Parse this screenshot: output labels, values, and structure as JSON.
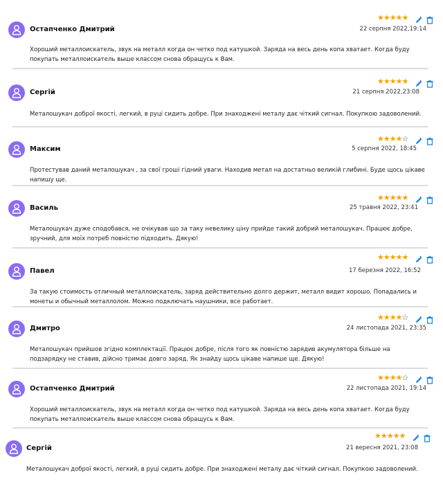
{
  "icons": {
    "avatar": "user-avatar-icon",
    "edit": "pencil-icon",
    "delete": "trash-icon",
    "star": "star-icon"
  },
  "colors": {
    "avatar": "#8a6cf2",
    "star": "#f5a300",
    "action": "#1e88e5",
    "divider": "#dcdcdc"
  },
  "reviews": [
    {
      "name": "Остапченко Дмитрий",
      "date": "22 серпня 2022,19:14",
      "rating": 5,
      "text": "Хороший металлоискатель, звук на металл когда он четко под катушкой. Заряда на весь день копа хватает. Когда буду покупать металлоискатель выше классом снова обращусь к Вам."
    },
    {
      "name": "Сергій",
      "date": "21 серпня 2022,23:08",
      "rating": 5,
      "text": "Металошукач доброї якості, легкий, в руці сидить добре. При знаходжені металу дає чіткий сигнал. Покупкою задоволений."
    },
    {
      "name": "Максим",
      "date": "5 серпня 2022, 18:45",
      "rating": 4,
      "text": "Протестував даний металошукач , за свої гроші гідний уваги. Находив метал на достатньо великій глибині. Буде щось цікаве напишу ще."
    },
    {
      "name": "Василь",
      "date": "25 травня 2022, 23:41",
      "rating": 5,
      "text": "Металошукач дуже сподобався, не очікував що за таку невелику ціну прийде такий добрий металошукач. Працює добре, зручний, для моїх потреб повністю підходить. Дякую!"
    },
    {
      "name": "Павел",
      "date": "17 березня 2022, 16:52",
      "rating": 5,
      "text": "За такую стоимость отличный металлоискатель, заряд действительно долго держит, металл видит хорошо. Попадались и монеты и обычный металлолом. Можно подключать наушники, все работает."
    },
    {
      "name": "Дмитро",
      "date": "24 листопада 2021, 23:35",
      "rating": 4,
      "text": "Металошукач прийшов згідно комплектації. Працює добре, після того як повністю зарядив акумулятора більше на подзарядку не ставив, дійсно тримає довго заряд. Як знайду щось цікаве напише ще. Дякую!"
    },
    {
      "name": "Остапченко Дмитрий",
      "date": "22 листопада 2021, 19:14",
      "rating": 4,
      "text": "Хороший металлоискатель, звук на металл когда он четко под катушкой. Заряда на весь день копа хватает. Когда буду покупать металлоискатель выше классом снова обращусь к Вам."
    },
    {
      "name": "Сергій",
      "date": "21 вересня 2021, 23:08",
      "rating": 5,
      "text": "Металошукач доброї якості, легкий, в руці сидить добре. При знаходжені металу дає чіткий сигнал. Покупкою задоволений."
    }
  ]
}
